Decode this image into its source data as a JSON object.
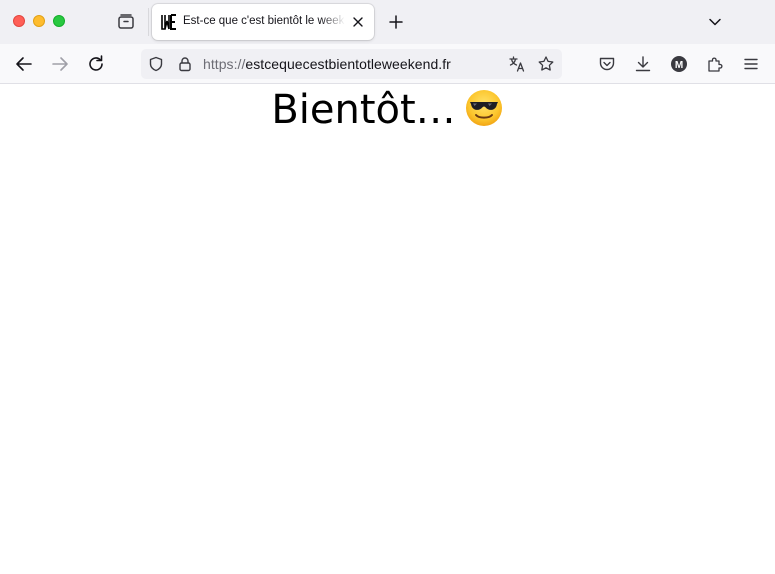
{
  "browser": {
    "tab": {
      "title": "Est-ce que c'est bientôt le weekend ?",
      "favicon_text": "WE"
    },
    "address_bar": {
      "scheme": "https://",
      "host": "estcequecestbientotleweekend.fr"
    },
    "toolbar": {
      "account_initial": "M"
    },
    "icons": [
      "tab-overview-icon",
      "close-icon",
      "plus-icon",
      "chevron-down-icon",
      "back-arrow-icon",
      "forward-arrow-icon",
      "reload-icon",
      "shield-icon",
      "lock-icon",
      "translate-icon",
      "star-icon",
      "pocket-icon",
      "download-icon",
      "account-avatar-icon",
      "extensions-icon",
      "menu-icon"
    ],
    "colors": {
      "close": "#ff5f57",
      "minimize": "#febc2e",
      "maximize": "#28c840"
    }
  },
  "page": {
    "headline": "Bientôt…",
    "emoji": "smiling-face-with-sunglasses"
  }
}
